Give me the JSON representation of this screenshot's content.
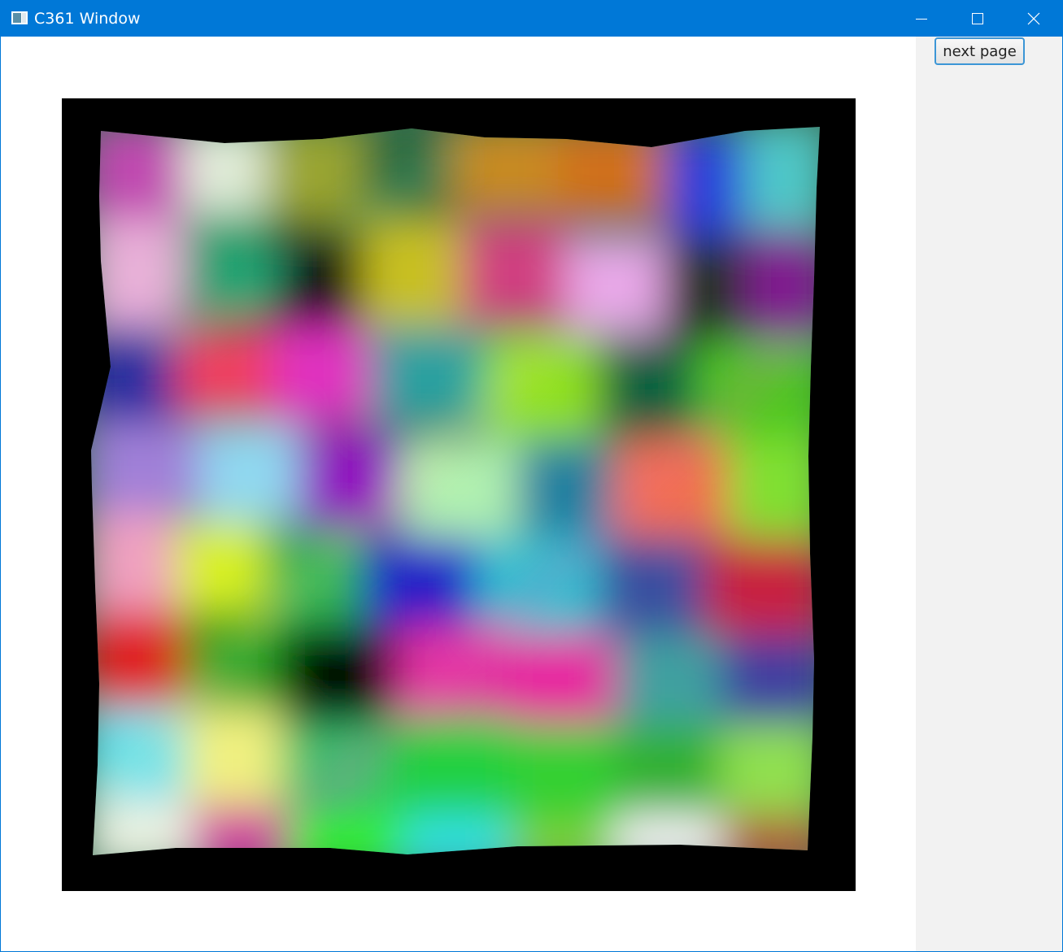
{
  "window": {
    "title": "C361 Window",
    "accent_color": "#0078d7",
    "icons": {
      "app": "app-window-icon",
      "minimize": "minimize-icon",
      "maximize": "maximize-icon",
      "close": "close-icon"
    }
  },
  "toolbar": {
    "next_page_label": "next page"
  }
}
